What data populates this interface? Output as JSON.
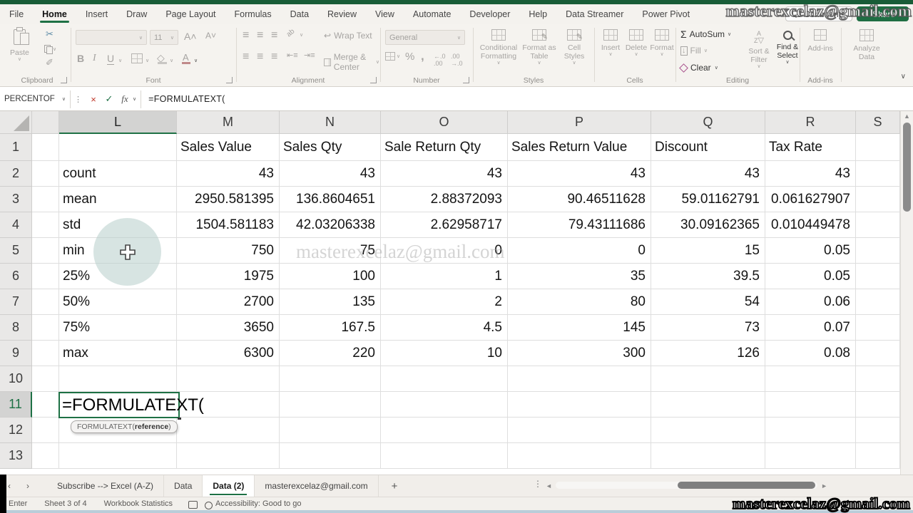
{
  "titlebar": {
    "watermark": "masterexcelaz@gmail.com",
    "comments_label": "Comments",
    "share_label": "Share"
  },
  "menu": {
    "tabs": [
      {
        "label": "File",
        "active": false
      },
      {
        "label": "Home",
        "active": true
      },
      {
        "label": "Insert",
        "active": false
      },
      {
        "label": "Draw",
        "active": false
      },
      {
        "label": "Page Layout",
        "active": false
      },
      {
        "label": "Formulas",
        "active": false
      },
      {
        "label": "Data",
        "active": false
      },
      {
        "label": "Review",
        "active": false
      },
      {
        "label": "View",
        "active": false
      },
      {
        "label": "Automate",
        "active": false
      },
      {
        "label": "Developer",
        "active": false
      },
      {
        "label": "Help",
        "active": false
      },
      {
        "label": "Data Streamer",
        "active": false
      },
      {
        "label": "Power Pivot",
        "active": false
      }
    ]
  },
  "ribbon": {
    "clipboard": {
      "label": "Clipboard",
      "paste": "Paste"
    },
    "font": {
      "label": "Font",
      "size": "11",
      "bold": "B",
      "italic": "I",
      "underline": "U"
    },
    "alignment": {
      "label": "Alignment",
      "wrap": "Wrap Text",
      "merge": "Merge & Center"
    },
    "number": {
      "label": "Number",
      "format": "General"
    },
    "styles": {
      "label": "Styles",
      "conditional": "Conditional Formatting",
      "format_table": "Format as Table",
      "cell_styles": "Cell Styles"
    },
    "cells": {
      "label": "Cells",
      "insert": "Insert",
      "delete": "Delete",
      "format": "Format"
    },
    "editing": {
      "label": "Editing",
      "autosum": "AutoSum",
      "fill": "Fill",
      "clear": "Clear",
      "sort": "Sort & Filter",
      "find": "Find & Select"
    },
    "addins": {
      "label": "Add-ins",
      "addins": "Add-ins",
      "analyze": "Analyze Data"
    }
  },
  "formula_bar": {
    "name_box": "PERCENTOF",
    "formula": "=FORMULATEXT("
  },
  "sheet": {
    "selected_column": "L",
    "selected_row": "11",
    "columns": [
      "L",
      "M",
      "N",
      "O",
      "P",
      "Q",
      "R",
      "S"
    ],
    "visible_rows": [
      "1",
      "2",
      "3",
      "4",
      "5",
      "6",
      "7",
      "8",
      "9",
      "10",
      "11",
      "12",
      "13"
    ],
    "header_row": [
      "Sales Value",
      "Sales Qty",
      "Sale Return Qty",
      "Sales Return Value",
      "Discount",
      "Tax Rate"
    ],
    "stat_rows": [
      {
        "label": "count",
        "values": [
          "43",
          "43",
          "43",
          "43",
          "43",
          "43"
        ]
      },
      {
        "label": "mean",
        "values": [
          "2950.581395",
          "136.8604651",
          "2.88372093",
          "90.46511628",
          "59.01162791",
          "0.061627907"
        ]
      },
      {
        "label": "std",
        "values": [
          "1504.581183",
          "42.03206338",
          "2.62958717",
          "79.43111686",
          "30.09162365",
          "0.010449478"
        ]
      },
      {
        "label": "min",
        "values": [
          "750",
          "75",
          "0",
          "0",
          "15",
          "0.05"
        ]
      },
      {
        "label": "25%",
        "values": [
          "1975",
          "100",
          "1",
          "35",
          "39.5",
          "0.05"
        ]
      },
      {
        "label": "50%",
        "values": [
          "2700",
          "135",
          "2",
          "80",
          "54",
          "0.06"
        ]
      },
      {
        "label": "75%",
        "values": [
          "3650",
          "167.5",
          "4.5",
          "145",
          "73",
          "0.07"
        ]
      },
      {
        "label": "max",
        "values": [
          "6300",
          "220",
          "10",
          "300",
          "126",
          "0.08"
        ]
      }
    ],
    "edit_cell": {
      "row": "11",
      "column": "L",
      "text": "=FORMULATEXT(",
      "tooltip_fn": "FORMULATEXT(",
      "tooltip_arg": "reference",
      "tooltip_close": ")"
    },
    "watermark": "masterexcelaz@gmail.com"
  },
  "sheet_tabs": {
    "tabs": [
      {
        "label": "Subscribe --> Excel (A-Z)",
        "active": false
      },
      {
        "label": "Data",
        "active": false
      },
      {
        "label": "Data (2)",
        "active": true
      },
      {
        "label": "masterexcelaz@gmail.com",
        "active": false
      }
    ],
    "add_label": "+"
  },
  "status_bar": {
    "mode": "Enter",
    "sheet_info": "Sheet 3 of 4",
    "workbook_stats": "Workbook Statistics",
    "accessibility": "Accessibility: Good to go",
    "watermark": "masterexcelaz@gmail.com"
  }
}
